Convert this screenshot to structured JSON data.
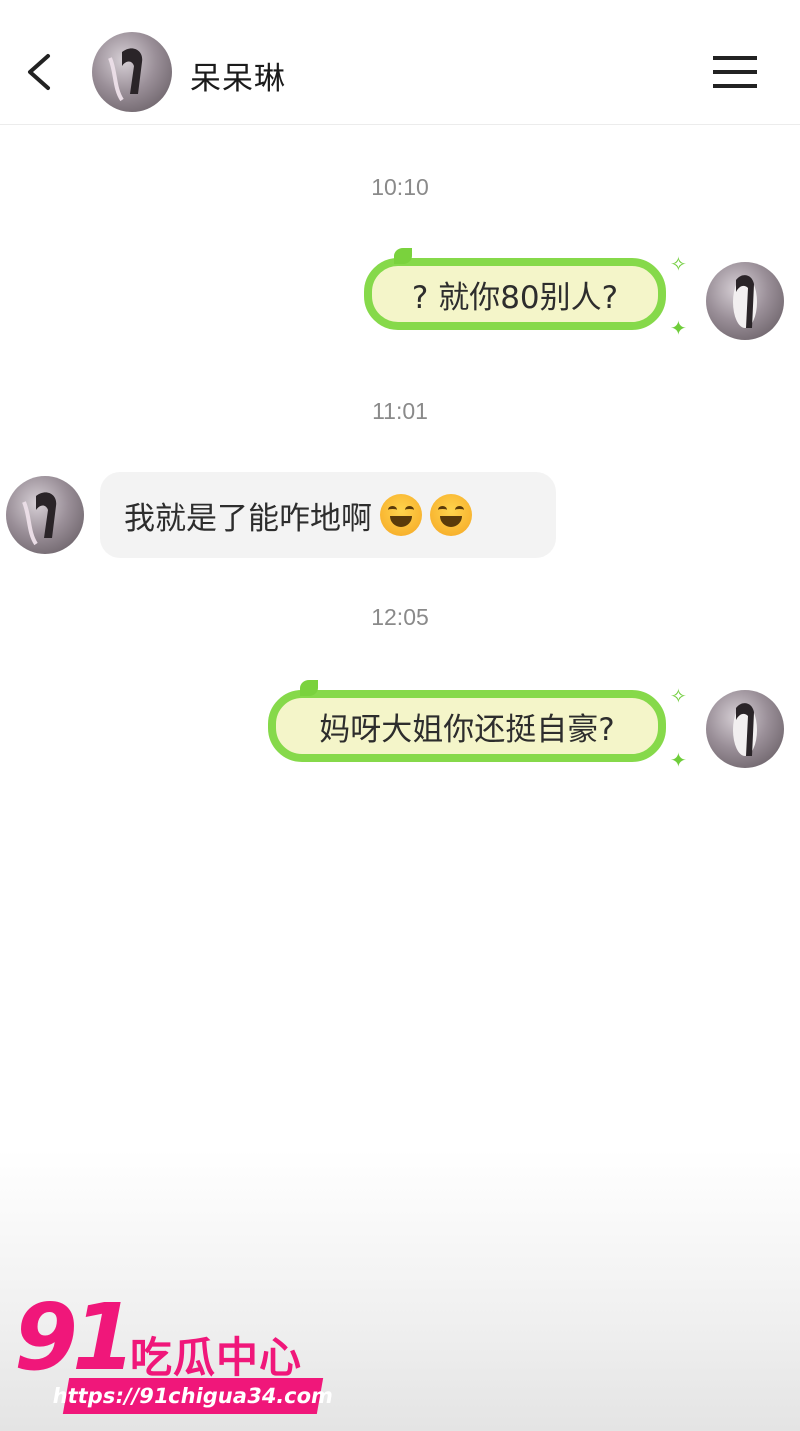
{
  "header": {
    "contact_name": "呆呆琳",
    "back_icon": "chevron-left-icon",
    "menu_icon": "hamburger-menu-icon"
  },
  "messages": [
    {
      "timestamp": "10:10",
      "side": "right",
      "text": "? 就你80别人?"
    },
    {
      "timestamp": "11:01",
      "side": "left",
      "text": "我就是了能咋地啊",
      "emoji_count": 2
    },
    {
      "timestamp": "12:05",
      "side": "right",
      "text": "妈呀大姐你还挺自豪?"
    }
  ],
  "colors": {
    "bubble_border": "#86d94a",
    "bubble_fill": "#f4f5c9",
    "incoming_bubble": "#f3f3f3",
    "watermark": "#f0177a"
  },
  "watermark": {
    "number": "91",
    "title": "吃瓜中心",
    "url": "https://91chigua34.com"
  }
}
